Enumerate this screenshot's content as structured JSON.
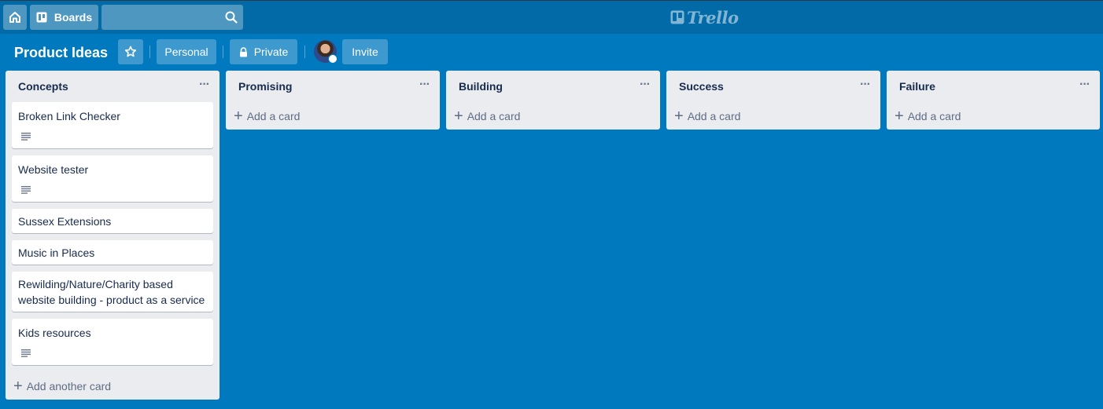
{
  "topbar": {
    "boards_label": "Boards",
    "search_placeholder": "",
    "logo_text": "Trello"
  },
  "board": {
    "title": "Product Ideas",
    "personal_label": "Personal",
    "private_label": "Private",
    "invite_label": "Invite"
  },
  "lists": [
    {
      "title": "Concepts",
      "add_label": "Add another card",
      "cards": [
        {
          "title": "Broken Link Checker",
          "has_description": true
        },
        {
          "title": "Website tester",
          "has_description": true
        },
        {
          "title": "Sussex Extensions",
          "has_description": false
        },
        {
          "title": "Music in Places",
          "has_description": false
        },
        {
          "title": "Rewilding/Nature/Charity based website building - product as a service",
          "has_description": false
        },
        {
          "title": "Kids resources",
          "has_description": true
        }
      ]
    },
    {
      "title": "Promising",
      "add_label": "Add a card",
      "cards": []
    },
    {
      "title": "Building",
      "add_label": "Add a card",
      "cards": []
    },
    {
      "title": "Success",
      "add_label": "Add a card",
      "cards": []
    },
    {
      "title": "Failure",
      "add_label": "Add a card",
      "cards": []
    }
  ],
  "colors": {
    "board_background": "#0079bf",
    "header_background": "#026aa7",
    "list_background": "#ebecf0",
    "card_background": "#ffffff"
  },
  "icons": {
    "home": "home-icon",
    "boards": "boards-icon",
    "search": "search-icon",
    "logo": "trello-logo-icon",
    "star": "star-icon",
    "lock": "lock-icon",
    "menu": "ellipsis-icon",
    "description": "description-icon",
    "plus": "plus-icon"
  }
}
